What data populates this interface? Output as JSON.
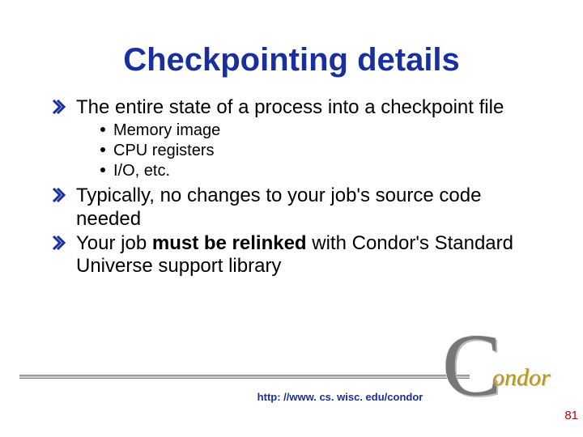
{
  "title": "Checkpointing details",
  "bullets": {
    "b1": "The entire state of a process into a checkpoint file",
    "b1_sub": {
      "s1": "Memory image",
      "s2": "CPU registers",
      "s3": "I/O, etc."
    },
    "b2": "Typically, no changes to your job's source code needed",
    "b3_pre": "Your job ",
    "b3_bold": "must be relinked",
    "b3_post": " with Condor's Standard Universe support library"
  },
  "footer_url": "http: //www. cs. wisc. edu/condor",
  "page_number": "81",
  "logo": {
    "c": "C",
    "rest": "ondor"
  }
}
